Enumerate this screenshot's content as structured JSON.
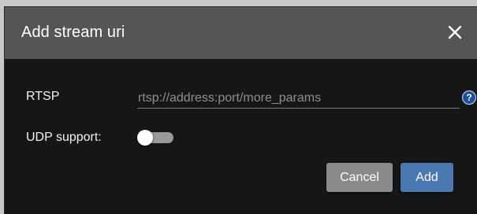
{
  "dialog": {
    "title": "Add stream uri",
    "close_icon": "close-icon"
  },
  "form": {
    "rtsp": {
      "label": "RTSP",
      "value": "",
      "placeholder": "rtsp://address:port/more_params",
      "help_icon": "help-icon",
      "help_glyph": "?"
    },
    "udp": {
      "label": "UDP support:",
      "enabled": false
    }
  },
  "actions": {
    "cancel_label": "Cancel",
    "add_label": "Add"
  },
  "colors": {
    "header_bg": "#555555",
    "dialog_bg": "#161616",
    "primary_button": "#4a78b0",
    "secondary_button": "#8a8a8a",
    "help_icon": "#1f4ea3"
  }
}
